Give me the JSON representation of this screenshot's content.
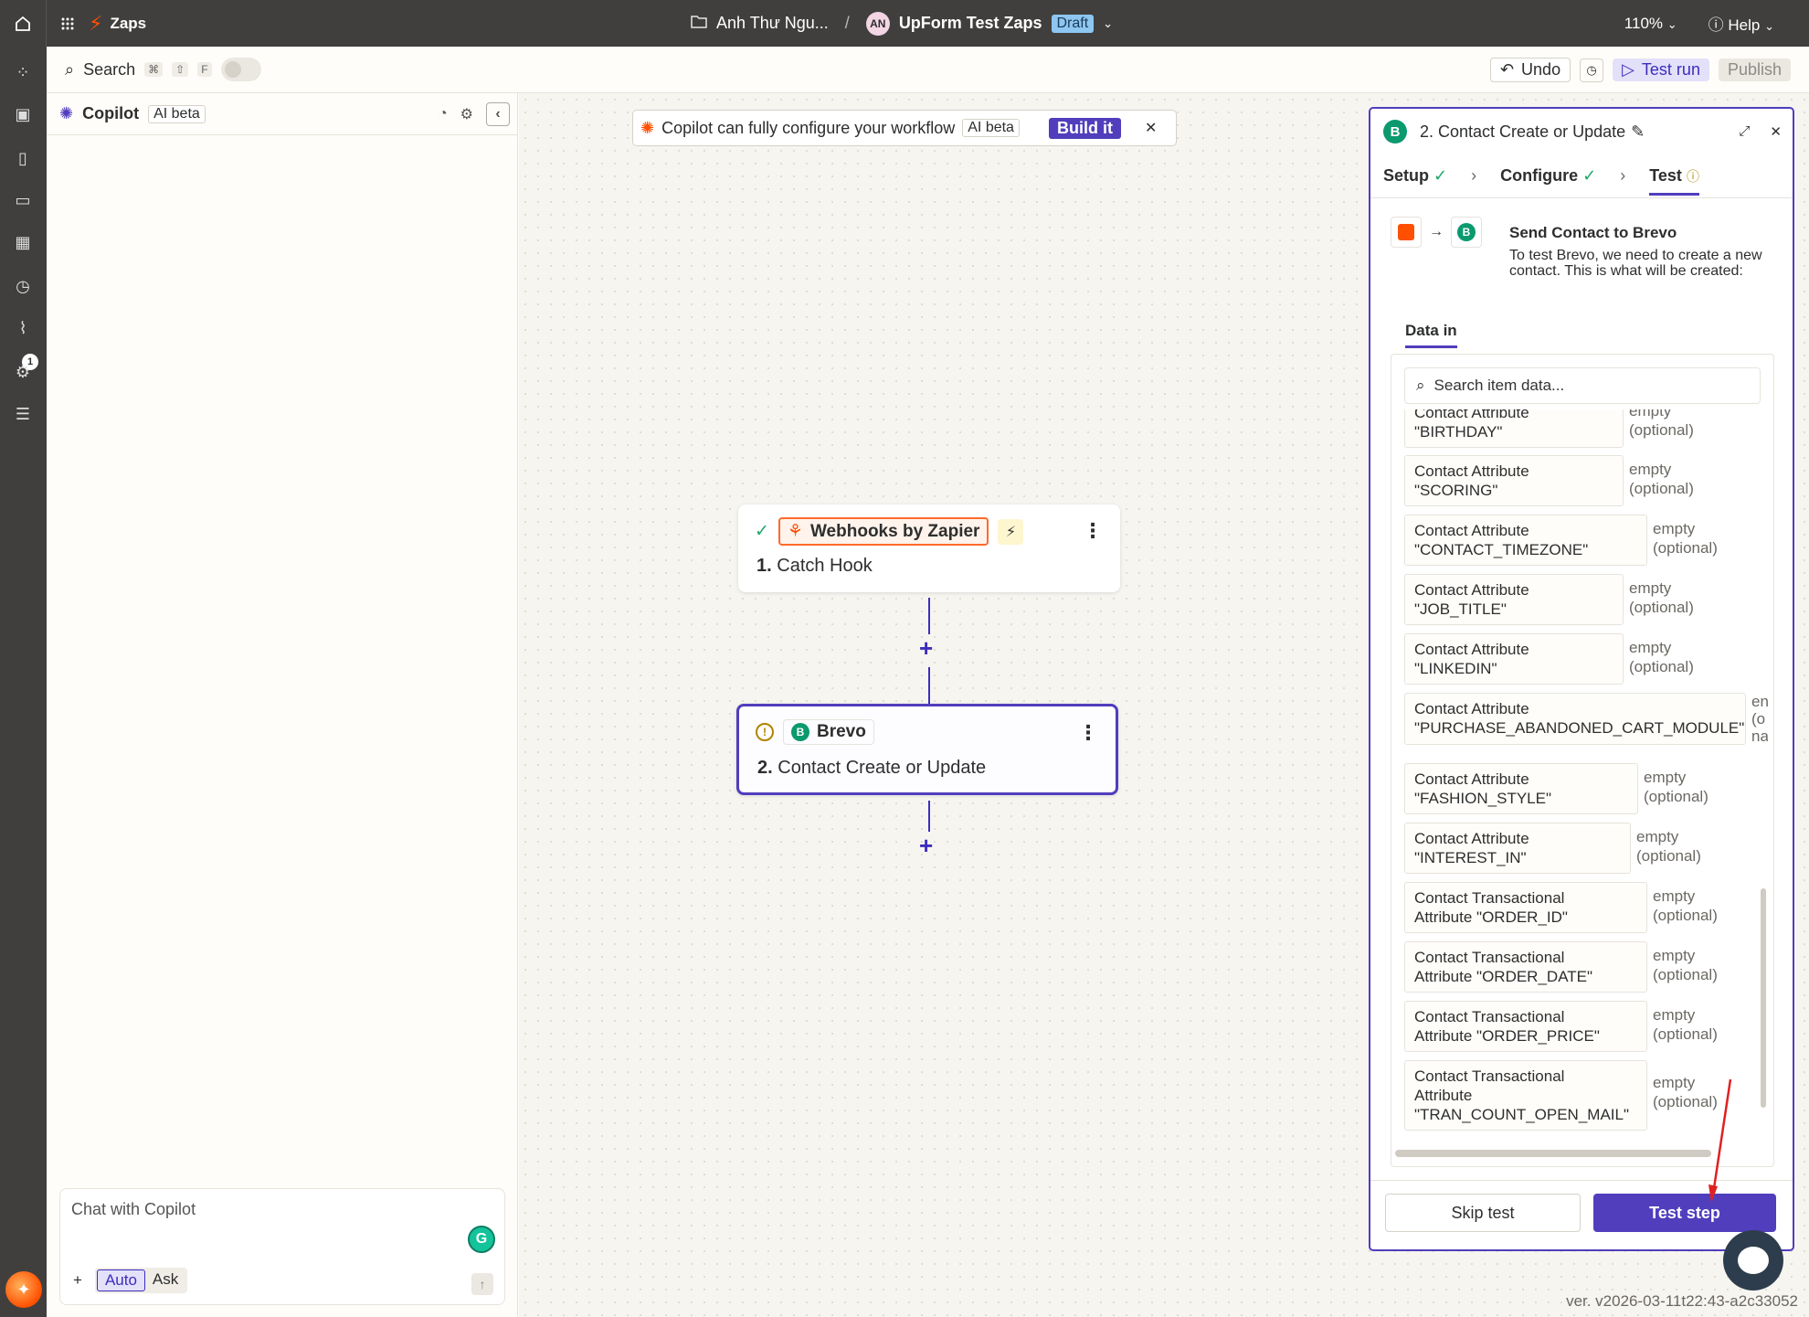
{
  "app": {
    "name": "Zaps"
  },
  "breadcrumb": {
    "folder": "Anh Thư Ngu...",
    "separator": "/",
    "avatar_initials": "AN",
    "zap_name": "UpForm Test Zaps",
    "status": "Draft"
  },
  "top_right": {
    "zoom": "110%",
    "help": "Help"
  },
  "toolbar": {
    "search": "Search",
    "shortcut_keys": [
      "⌘",
      "⇧",
      "F"
    ],
    "undo": "Undo",
    "test_run": "Test run",
    "publish": "Publish"
  },
  "rail": {
    "notification_count": "1"
  },
  "copilot": {
    "title": "Copilot",
    "tag": "AI beta",
    "chat_placeholder": "Chat with Copilot",
    "modes": [
      "Auto",
      "Ask"
    ],
    "grammarly": "G"
  },
  "banner": {
    "text": "Copilot can fully configure your workflow",
    "tag": "AI beta",
    "button": "Build it"
  },
  "nodes": [
    {
      "app": "Webhooks by Zapier",
      "number": "1.",
      "title": "Catch Hook"
    },
    {
      "app": "Brevo",
      "number": "2.",
      "title": "Contact Create or Update"
    }
  ],
  "panel": {
    "title": "2. Contact Create or Update",
    "tabs": [
      "Setup",
      "Configure",
      "Test"
    ],
    "send_title": "Send Contact to Brevo",
    "send_desc": "To test Brevo, we need to create a new contact. This is what will be created:",
    "data_tab": "Data in",
    "search_placeholder": "Search item data...",
    "items": [
      {
        "key": "Contact Attribute\n\"BIRTHDAY\"",
        "value": "empty\n(optional)"
      },
      {
        "key": "Contact Attribute\n\"SCORING\"",
        "value": "empty\n(optional)"
      },
      {
        "key": "Contact Attribute\n\"CONTACT_TIMEZONE\"",
        "value": "empty\n(optional)"
      },
      {
        "key": "Contact Attribute\n\"JOB_TITLE\"",
        "value": "empty\n(optional)"
      },
      {
        "key": "Contact Attribute\n\"LINKEDIN\"",
        "value": "empty\n(optional)"
      },
      {
        "key": "Contact Attribute\n\"PURCHASE_ABANDONED_CART_MODULE\"",
        "value": "en\n(o\nna"
      },
      {
        "key": "Contact Attribute\n\"FASHION_STYLE\"",
        "value": "empty\n(optional)"
      },
      {
        "key": "Contact Attribute\n\"INTEREST_IN\"",
        "value": "empty\n(optional)"
      },
      {
        "key": "Contact Transactional\nAttribute \"ORDER_ID\"",
        "value": "empty\n(optional)"
      },
      {
        "key": "Contact Transactional\nAttribute \"ORDER_DATE\"",
        "value": "empty\n(optional)"
      },
      {
        "key": "Contact Transactional\nAttribute \"ORDER_PRICE\"",
        "value": "empty\n(optional)"
      },
      {
        "key": "Contact Transactional\nAttribute\n\"TRAN_COUNT_OPEN_MAIL\"",
        "value": "empty\n(optional)"
      }
    ],
    "skip": "Skip test",
    "test_step": "Test step"
  },
  "version": "ver. v2026-03-11t22:43-a2c33052",
  "colors": {
    "accent": "#503ebd",
    "brand_orange": "#ff4f00",
    "success": "#19a86b",
    "warning": "#b08400"
  }
}
